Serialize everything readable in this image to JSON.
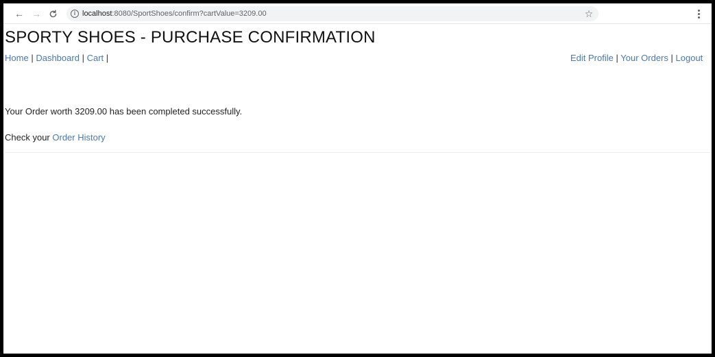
{
  "browser": {
    "back_icon": "←",
    "forward_icon": "→",
    "reload_icon": "C",
    "url_host": "localhost",
    "url_path": ":8080/SportShoes/confirm?cartValue=3209.00",
    "star_icon": "☆"
  },
  "page": {
    "title": "SPORTY SHOES - PURCHASE CONFIRMATION",
    "nav_left": {
      "home": "Home",
      "dashboard": "Dashboard",
      "cart": "Cart"
    },
    "nav_right": {
      "edit_profile": "Edit Profile",
      "your_orders": "Your Orders",
      "logout": "Logout"
    },
    "separator": "|",
    "message": "Your Order worth 3209.00 has been completed successfully.",
    "history_prefix": "Check your",
    "history_link": "Order History"
  }
}
